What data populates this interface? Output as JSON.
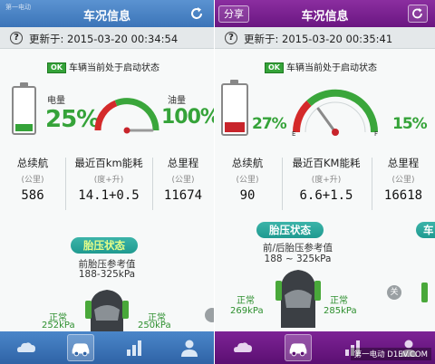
{
  "colors": {
    "header_blue": "#3b74b8",
    "header_purple": "#6a1681",
    "battery_green": "#35a339",
    "battery_red": "#c8242b",
    "gauge_green": "#3aa63b",
    "gauge_red": "#d42a2a",
    "pill_teal": "#1f9a90"
  },
  "panel1": {
    "watermark": "第一电动",
    "header_title": "车况信息",
    "update_text": "更新于: 2015-03-20 00:34:54",
    "status_ok": "OK",
    "status_text": "车辆当前处于启动状态",
    "battery": {
      "label": "电量",
      "percent_text": "25%",
      "level": 0.25
    },
    "fuel": {
      "label": "油量",
      "percent_text": "100%",
      "level": 1.0
    },
    "stats": [
      {
        "header": "总续航",
        "unit": "(公里)",
        "value": "586"
      },
      {
        "header": "最近百km能耗",
        "unit": "(度+升)",
        "value": "14.1+0.5"
      },
      {
        "header": "总里程",
        "unit": "(公里)",
        "value": "11674"
      }
    ],
    "tire_pill": "胎压状态",
    "tire_ref_label": "前胎压参考值",
    "tire_ref_value": "188-325kPa",
    "tires": [
      {
        "state": "正常",
        "value": "252kPa"
      },
      {
        "state": "正常",
        "value": "250kPa"
      }
    ]
  },
  "panel2": {
    "share_label": "分享",
    "header_title": "车况信息",
    "update_text": "更新于: 2015-03-20 00:35:41",
    "status_ok": "OK",
    "status_text": "车辆当前处于启动状态",
    "battery": {
      "percent_text": "27%",
      "level": 0.27
    },
    "fuel": {
      "percent_text": "15%",
      "level": 0.15,
      "gauge_e": "E",
      "gauge_f": "F"
    },
    "stats": [
      {
        "header": "总续航",
        "unit": "(公里)",
        "value": "90"
      },
      {
        "header": "最近百KM能耗",
        "unit": "(度+升)",
        "value": "6.6+1.5"
      },
      {
        "header": "总里程",
        "unit": "(公里)",
        "value": "16618"
      }
    ],
    "tire_pill": "胎压状态",
    "tire_pill_partial": "车",
    "tire_ref_label": "前/后胎压参考值",
    "tire_ref_value": "188 ~ 325kPa",
    "tires": [
      {
        "state": "正常",
        "value": "269kPa"
      },
      {
        "state": "正常",
        "value": "285kPa"
      }
    ],
    "side_button": "关",
    "footer_watermark": "第一电动 D1EV.COM"
  },
  "nav_icons": [
    "cloud-icon",
    "car-icon",
    "chart-icon",
    "person-icon"
  ]
}
